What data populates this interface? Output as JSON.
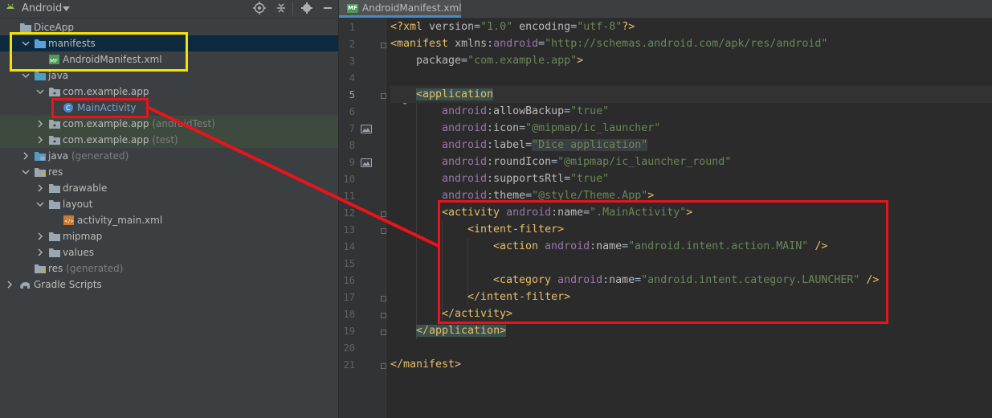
{
  "project_panel": {
    "view_selector": "Android",
    "tree": [
      {
        "label": "DiceApp",
        "extra": ""
      },
      {
        "label": "manifests",
        "extra": ""
      },
      {
        "label": "AndroidManifest.xml",
        "extra": ""
      },
      {
        "label": "java",
        "extra": ""
      },
      {
        "label": "com.example.app",
        "extra": ""
      },
      {
        "label": "MainActivity",
        "extra": ""
      },
      {
        "label": "com.example.app",
        "extra": "(androidTest)"
      },
      {
        "label": "com.example.app",
        "extra": "(test)"
      },
      {
        "label": "java",
        "extra": "(generated)"
      },
      {
        "label": "res",
        "extra": ""
      },
      {
        "label": "drawable",
        "extra": ""
      },
      {
        "label": "layout",
        "extra": ""
      },
      {
        "label": "activity_main.xml",
        "extra": ""
      },
      {
        "label": "mipmap",
        "extra": ""
      },
      {
        "label": "values",
        "extra": ""
      },
      {
        "label": "res",
        "extra": "(generated)"
      },
      {
        "label": "Gradle Scripts",
        "extra": ""
      }
    ]
  },
  "editor": {
    "tab_label": "AndroidManifest.xml",
    "line_numbers": [
      "1",
      "2",
      "3",
      "4",
      "5",
      "6",
      "7",
      "8",
      "9",
      "10",
      "11",
      "12",
      "13",
      "14",
      "15",
      "16",
      "17",
      "18",
      "19",
      "20",
      "21"
    ],
    "code": {
      "l1_pi_open": "<?xml ",
      "l1_attr1": "version",
      "l1_eq1": "=",
      "l1_val1": "\"1.0\"",
      "l1_attr2": " encoding",
      "l1_eq2": "=",
      "l1_val2": "\"utf-8\"",
      "l1_pi_close": "?>",
      "l2_open": "<manifest ",
      "l2_attr": "xmlns:",
      "l2_ns": "android",
      "l2_eq": "=",
      "l2_val": "\"http://schemas.android.com/apk/res/android\"",
      "l3_attr": "package",
      "l3_eq": "=",
      "l3_val": "\"com.example.app\"",
      "l3_close": ">",
      "l5_tag": "<application",
      "ns": "android",
      "colon": ":",
      "l6_attr": "allowBackup",
      "l6_val": "\"true\"",
      "l7_attr": "icon",
      "l7_val": "\"@mipmap/ic_launcher\"",
      "l8_attr": "label",
      "l8_val": "\"Dice application\"",
      "l9_attr": "roundIcon",
      "l9_val": "\"@mipmap/ic_launcher_round\"",
      "l10_attr": "supportsRtl",
      "l10_val": "\"true\"",
      "l11_attr": "theme",
      "l11_val": "\"@style/Theme.App\"",
      "l11_close": ">",
      "l12_tag": "<activity ",
      "l12_attr": "name",
      "l12_val": "\".MainActivity\"",
      "l12_close": ">",
      "l13_tag": "<intent-filter>",
      "l14_tag": "<action ",
      "l14_attr": "name",
      "l14_val": "\"android.intent.action.MAIN\"",
      "l14_close": " />",
      "l16_tag": "<category ",
      "l16_attr": "name",
      "l16_val": "\"android.intent.category.LAUNCHER\"",
      "l16_close": " />",
      "l17_tag": "</intent-filter>",
      "l18_tag": "</activity>",
      "l19_tag": "</application>",
      "l21_tag": "</manifest>",
      "eq": "="
    }
  },
  "colors": {
    "annotation_yellow": "#f5e300",
    "annotation_red": "#e8141c"
  }
}
